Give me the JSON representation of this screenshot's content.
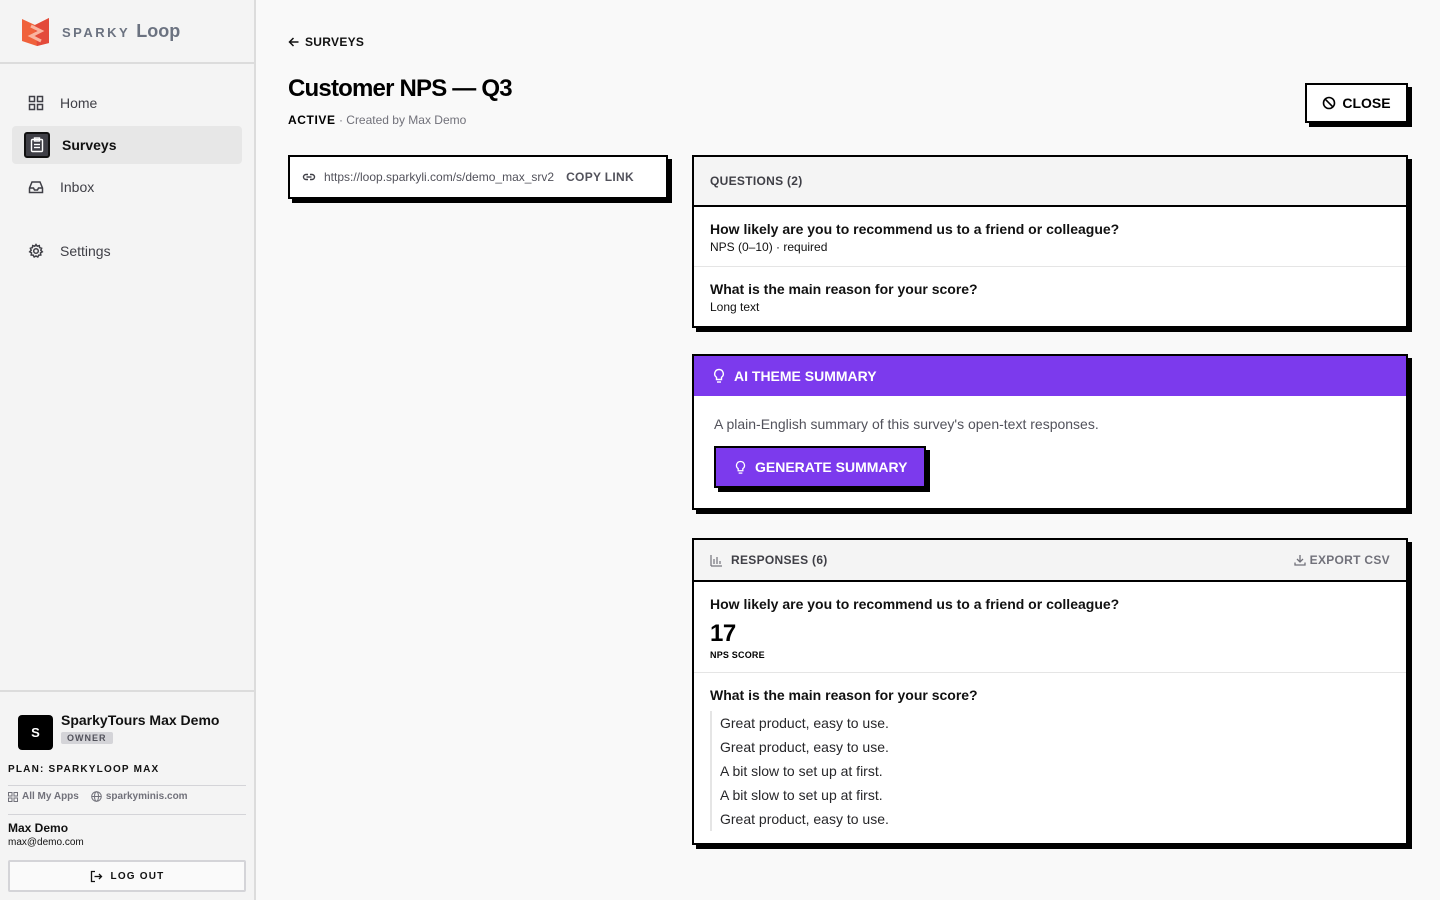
{
  "brand": {
    "sparky": "SPARKY",
    "loop": "Loop"
  },
  "sidebar": {
    "items": [
      {
        "label": "Home",
        "icon": "grid-icon"
      },
      {
        "label": "Surveys",
        "icon": "clipboard-icon",
        "active": true
      },
      {
        "label": "Inbox",
        "icon": "inbox-icon"
      },
      {
        "label": "Settings",
        "icon": "gear-icon"
      }
    ],
    "org": {
      "avatar_letter": "S",
      "name": "SparkyTours Max Demo",
      "role": "OWNER"
    },
    "plan": "PLAN: SPARKYLOOP MAX",
    "links": {
      "apps": "All My Apps",
      "site": "sparkyminis.com"
    },
    "user": {
      "name": "Max Demo",
      "email": "max@demo.com"
    },
    "logout_label": "LOG OUT"
  },
  "header": {
    "back_label": "SURVEYS",
    "title": "Customer NPS — Q3",
    "status": "ACTIVE",
    "created_by": " · Created by Max Demo",
    "close_label": "CLOSE"
  },
  "share": {
    "url": "https://loop.sparkyli.com/s/demo_max_srv2",
    "copy_label": "COPY LINK"
  },
  "questions": {
    "header": "QUESTIONS (2)",
    "items": [
      {
        "text": "How likely are you to recommend us to a friend or colleague?",
        "meta": "NPS (0–10) · required"
      },
      {
        "text": "What is the main reason for your score?",
        "meta": "Long text"
      }
    ]
  },
  "ai_summary": {
    "header": "AI THEME SUMMARY",
    "description": "A plain-English summary of this survey's open-text responses.",
    "button_label": "GENERATE SUMMARY"
  },
  "responses": {
    "header": "RESPONSES (6)",
    "export_label": "EXPORT CSV",
    "nps": {
      "question": "How likely are you to recommend us to a friend or colleague?",
      "score": "17",
      "score_label": "NPS SCORE"
    },
    "text": {
      "question": "What is the main reason for your score?",
      "answers": [
        "Great product, easy to use.",
        "Great product, easy to use.",
        "A bit slow to set up at first.",
        "A bit slow to set up at first.",
        "Great product, easy to use."
      ]
    }
  },
  "colors": {
    "accent": "#7c3aed",
    "border": "#000000",
    "sidebar_bg": "#f4f4f4"
  }
}
